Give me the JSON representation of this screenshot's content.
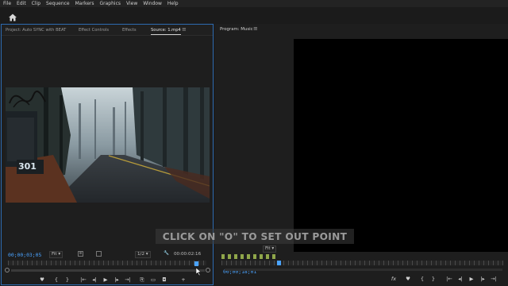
{
  "menu": [
    "File",
    "Edit",
    "Clip",
    "Sequence",
    "Markers",
    "Graphics",
    "View",
    "Window",
    "Help"
  ],
  "source_panel": {
    "tabs": [
      "Project: Auto SYNC with BEAT",
      "Effect Controls",
      "Effects",
      "Source: 1.mp4"
    ],
    "active_tab": 3,
    "mailbox_number": "301",
    "timecode_current": "00;00;03;05",
    "fit_label": "Fit",
    "resolution": "1/2",
    "duration": "00:00:02:16",
    "controls": [
      "marker",
      "in",
      "out",
      "step-back",
      "play",
      "step-forward",
      "go-out",
      "insert",
      "overwrite",
      "export",
      "add"
    ]
  },
  "program_panel": {
    "title": "Program: Music",
    "timecode_current": "00;00;18;01",
    "fit_label": "Fit",
    "controls": [
      "fx",
      "marker",
      "in",
      "out",
      "go-in",
      "step-back",
      "play",
      "step-forward",
      "go-out"
    ]
  },
  "caption": "CLICK ON \"O\" TO SET OUT POINT",
  "colors": {
    "accent": "#4aa3ff",
    "panel_border": "#2d6bb1"
  }
}
